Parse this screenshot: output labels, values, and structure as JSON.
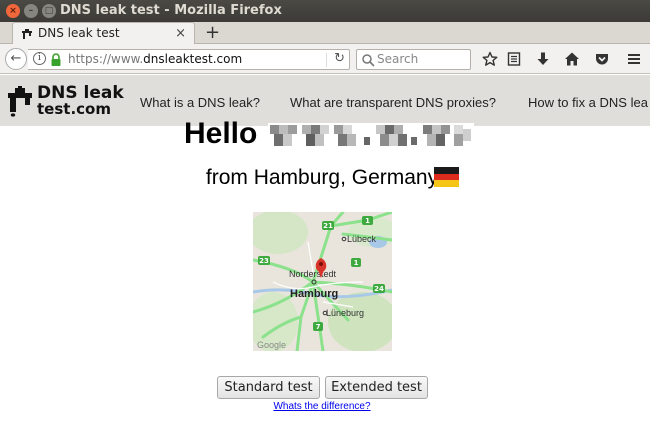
{
  "window": {
    "title": "DNS leak test - Mozilla Firefox",
    "close_glyph": "×",
    "min_glyph": "–",
    "max_glyph": "□"
  },
  "tabs": [
    {
      "label": "DNS leak test",
      "close_glyph": "×"
    }
  ],
  "new_tab_glyph": "+",
  "navbar": {
    "back_glyph": "←",
    "info_glyph": "i",
    "url_scheme": "https://www.",
    "url_host": "dnsleaktest.com",
    "reload_glyph": "↻",
    "search_placeholder": "Search"
  },
  "toolbar_icons": [
    "bookmark-star-icon",
    "reading-list-icon",
    "download-icon",
    "home-icon",
    "pocket-icon",
    "menu-icon"
  ],
  "site": {
    "logo_line1": "DNS leak",
    "logo_line2": "test.com",
    "nav_links": [
      "What is a DNS leak?",
      "What are transparent DNS proxies?",
      "How to fix a DNS lea"
    ]
  },
  "main": {
    "hello": "Hello",
    "from": "from Hamburg, Germany",
    "map_labels": {
      "lubeck": "Lübeck",
      "norderstedt": "Norderstedt",
      "hamburg": "Hamburg",
      "luneburg": "Lüneburg",
      "google": "Google"
    },
    "road_badges": [
      "1",
      "21",
      "23",
      "1",
      "24",
      "7"
    ],
    "standard_button": "Standard test",
    "extended_button": "Extended test",
    "difference_link": "Whats the difference?"
  },
  "colors": {
    "titlebar": "#3c3b37",
    "close": "#f1673c",
    "site_header": "#dfdedb",
    "link": "#0000ee",
    "map_road": "#8ce28c",
    "map_pin": "#d9342b",
    "secure_lock": "#3aa12d"
  }
}
